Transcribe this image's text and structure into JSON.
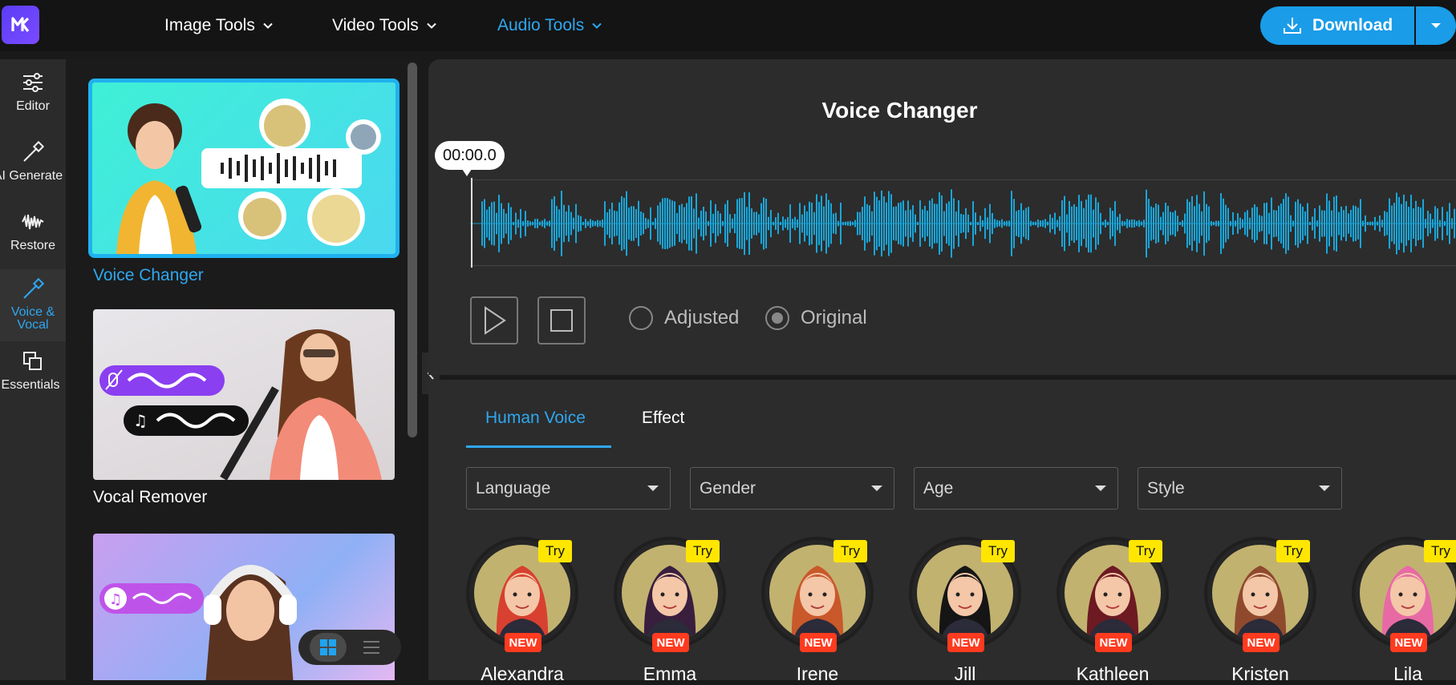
{
  "header": {
    "nav": [
      {
        "label": "Image Tools",
        "active": false
      },
      {
        "label": "Video Tools",
        "active": false
      },
      {
        "label": "Audio Tools",
        "active": true
      }
    ],
    "download_label": "Download",
    "accent_color": "#2fa7f0"
  },
  "rail": {
    "items": [
      {
        "label": "Editor",
        "icon": "sliders-icon"
      },
      {
        "label": "AI Generate",
        "icon": "magic-wand-icon"
      },
      {
        "label": "Restore",
        "icon": "waveform-icon"
      },
      {
        "label": "Voice & Vocal",
        "icon": "magic-wand-icon",
        "active": true
      },
      {
        "label": "Essentials",
        "icon": "squares-icon"
      }
    ]
  },
  "tools": {
    "cards": [
      {
        "label": "Voice Changer",
        "active": true
      },
      {
        "label": "Vocal Remover",
        "active": false
      },
      {
        "label": "",
        "active": false
      }
    ]
  },
  "editor": {
    "title": "Voice Changer",
    "timecode": "00:00.0",
    "options": [
      {
        "label": "Adjusted",
        "selected": false
      },
      {
        "label": "Original",
        "selected": true
      }
    ]
  },
  "voices": {
    "tabs": [
      {
        "label": "Human Voice",
        "active": true
      },
      {
        "label": "Effect",
        "active": false
      }
    ],
    "filters": [
      "Language",
      "Gender",
      "Age",
      "Style"
    ],
    "badge_try": "Try",
    "badge_new": "NEW",
    "items": [
      {
        "name": "Alexandra",
        "hair": "#d8402f"
      },
      {
        "name": "Emma",
        "hair": "#3a1e3e"
      },
      {
        "name": "Irene",
        "hair": "#c9582a"
      },
      {
        "name": "Jill",
        "hair": "#151515"
      },
      {
        "name": "Kathleen",
        "hair": "#6d1a22"
      },
      {
        "name": "Kristen",
        "hair": "#8f4a2e"
      },
      {
        "name": "Lila",
        "hair": "#e86aa5"
      }
    ]
  }
}
